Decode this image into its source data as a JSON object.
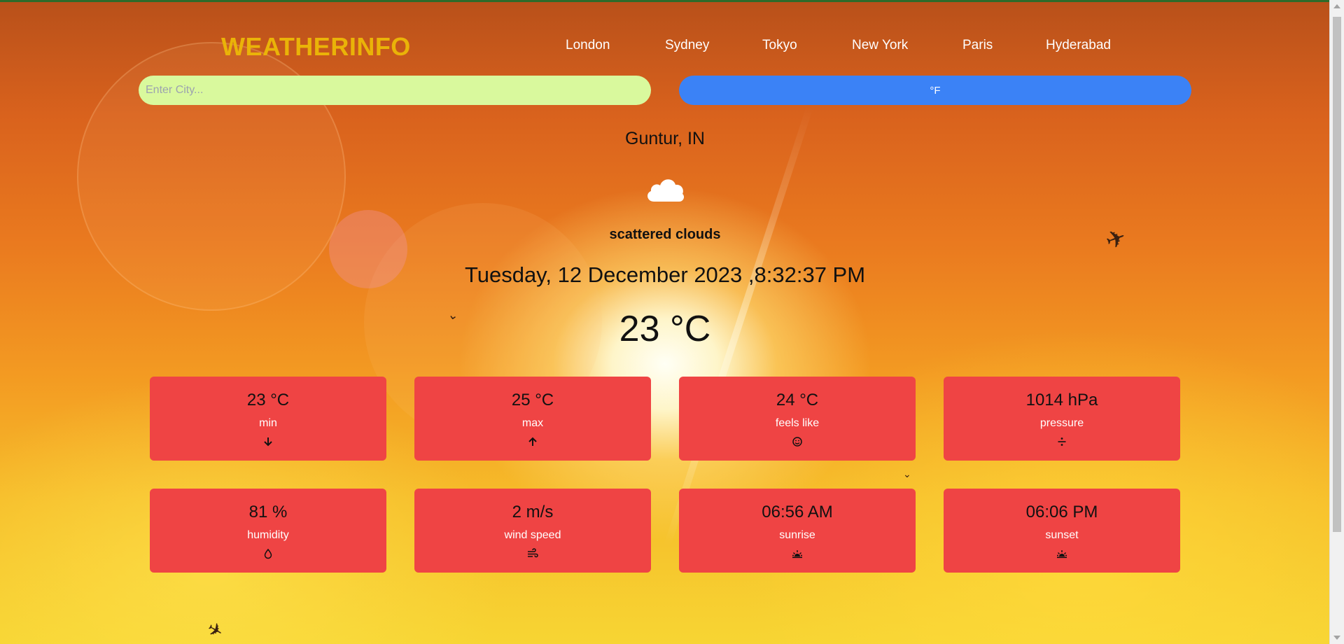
{
  "app": {
    "brand": "WEATHERINFO"
  },
  "nav": {
    "cities": [
      "London",
      "Sydney",
      "Tokyo",
      "New York",
      "Paris",
      "Hyderabad"
    ]
  },
  "search": {
    "placeholder": "Enter City...",
    "value": ""
  },
  "unit_toggle": {
    "label": "°F"
  },
  "weather": {
    "location": "Guntur, IN",
    "icon": "cloud-icon",
    "condition": "scattered clouds",
    "datetime": "Tuesday, 12 December 2023 ,8:32:37 PM",
    "temperature": "23 °C"
  },
  "stats": [
    {
      "value": "23 °C",
      "label": "min",
      "icon": "arrow-down-icon"
    },
    {
      "value": "25 °C",
      "label": "max",
      "icon": "arrow-up-icon"
    },
    {
      "value": "24 °C",
      "label": "feels like",
      "icon": "smile-icon"
    },
    {
      "value": "1014 hPa",
      "label": "pressure",
      "icon": "divide-icon"
    },
    {
      "value": "81 %",
      "label": "humidity",
      "icon": "droplet-icon"
    },
    {
      "value": "2 m/s",
      "label": "wind speed",
      "icon": "wind-icon"
    },
    {
      "value": "06:56 AM",
      "label": "sunrise",
      "icon": "sunrise-icon"
    },
    {
      "value": "06:06 PM",
      "label": "sunset",
      "icon": "sunset-icon"
    }
  ],
  "colors": {
    "brand": "#eab308",
    "search_bg": "#d9f99d",
    "unit_button_bg": "#3b82f6",
    "card_bg": "#ef4444"
  }
}
